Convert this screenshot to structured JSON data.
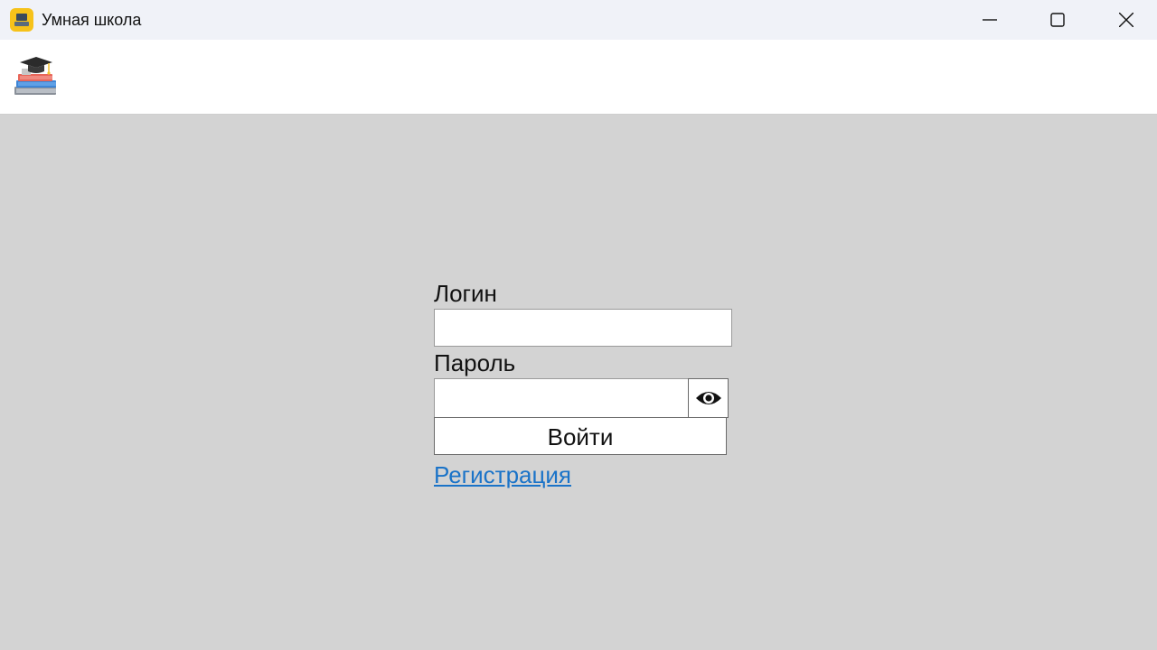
{
  "window": {
    "title": "Умная школа"
  },
  "form": {
    "login_label": "Логин",
    "login_value": "",
    "password_label": "Пароль",
    "password_value": "",
    "submit_label": "Войти",
    "register_link": "Регистрация"
  },
  "icons": {
    "app": "app-icon",
    "logo": "graduation-books-icon",
    "show_password": "eye-icon",
    "minimize": "minimize-icon",
    "maximize": "maximize-icon",
    "close": "close-icon"
  },
  "colors": {
    "background": "#d3d3d3",
    "link": "#1a73c8",
    "app_icon": "#f6c21a"
  }
}
